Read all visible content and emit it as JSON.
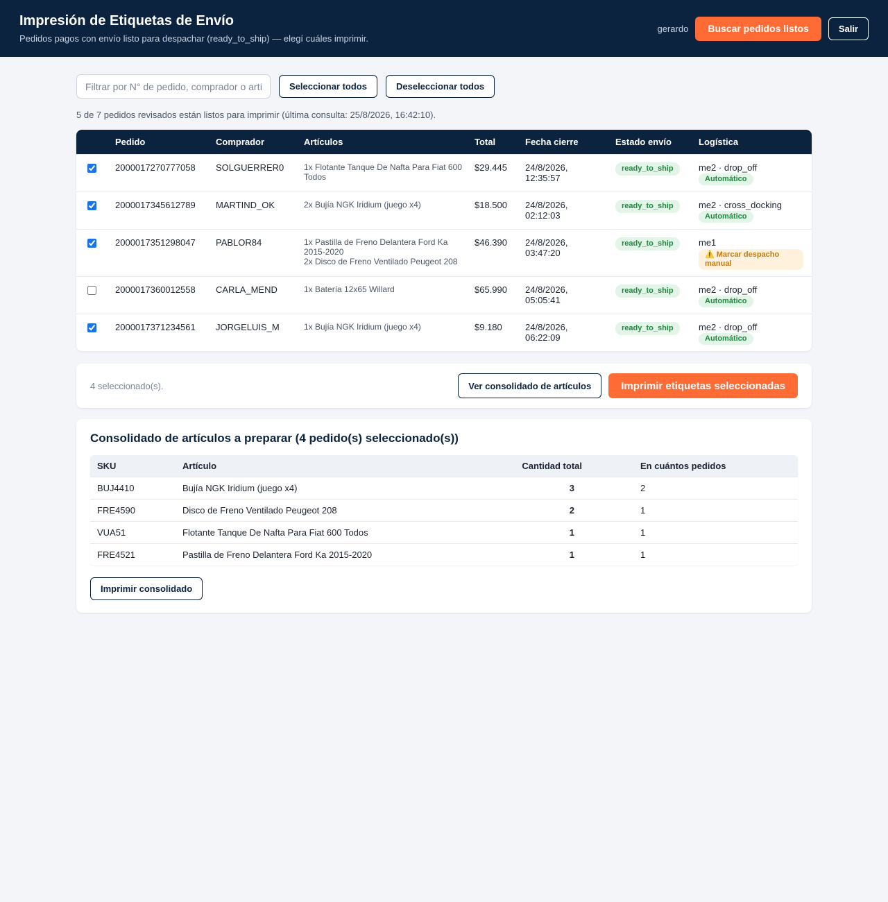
{
  "header": {
    "title": "Impresión de Etiquetas de Envío",
    "subtitle": "Pedidos pagos con envío listo para despachar (ready_to_ship) — elegí cuáles imprimir.",
    "user": "gerardo",
    "search_button": "Buscar pedidos listos",
    "logout_button": "Salir"
  },
  "toolbar": {
    "filter_placeholder": "Filtrar por N° de pedido, comprador o artículo",
    "select_all": "Seleccionar todos",
    "deselect_all": "Deseleccionar todos"
  },
  "status_line": "5 de 7 pedidos revisados están listos para imprimir (última consulta: 25/8/2026, 16:42:10).",
  "orders": {
    "columns": [
      "Pedido",
      "Comprador",
      "Artículos",
      "Total",
      "Fecha cierre",
      "Estado envío",
      "Logística"
    ],
    "rows": [
      {
        "checked": true,
        "id": "2000017270777058",
        "buyer": "SOLGUERRER0",
        "items": [
          "1x Flotante Tanque De Nafta Para Fiat 600 Todos"
        ],
        "total": "$29.445",
        "date": "24/8/2026,",
        "time": "12:35:57",
        "status": "ready_to_ship",
        "logistic": "me2 · drop_off",
        "mode": "Automático"
      },
      {
        "checked": true,
        "id": "2000017345612789",
        "buyer": "MARTIND_OK",
        "items": [
          "2x Bujía NGK Iridium (juego x4)"
        ],
        "total": "$18.500",
        "date": "24/8/2026,",
        "time": "02:12:03",
        "status": "ready_to_ship",
        "logistic": "me2 · cross_docking",
        "mode": "Automático"
      },
      {
        "checked": true,
        "id": "2000017351298047",
        "buyer": "PABLOR84",
        "items": [
          "1x Pastilla de Freno Delantera Ford Ka 2015-2020",
          "2x Disco de Freno Ventilado Peugeot 208"
        ],
        "total": "$46.390",
        "date": "24/8/2026,",
        "time": "03:47:20",
        "status": "ready_to_ship",
        "logistic": "me1",
        "warning": "⚠️ Marcar despacho manual"
      },
      {
        "checked": false,
        "id": "2000017360012558",
        "buyer": "CARLA_MEND",
        "items": [
          "1x Batería 12x65 Willard"
        ],
        "total": "$65.990",
        "date": "24/8/2026,",
        "time": "05:05:41",
        "status": "ready_to_ship",
        "logistic": "me2 · drop_off",
        "mode": "Automático"
      },
      {
        "checked": true,
        "id": "2000017371234561",
        "buyer": "JORGELUIS_M",
        "items": [
          "1x Bujía NGK Iridium (juego x4)"
        ],
        "total": "$9.180",
        "date": "24/8/2026,",
        "time": "06:22:09",
        "status": "ready_to_ship",
        "logistic": "me2 · drop_off",
        "mode": "Automático"
      }
    ]
  },
  "actions": {
    "selected_count": "4 seleccionado(s).",
    "view_consolidated": "Ver consolidado de artículos",
    "print_selected": "Imprimir etiquetas seleccionadas"
  },
  "consolidated": {
    "title": "Consolidado de artículos a preparar (4 pedido(s) seleccionado(s))",
    "columns": [
      "SKU",
      "Artículo",
      "Cantidad total",
      "En cuántos pedidos"
    ],
    "rows": [
      {
        "sku": "BUJ4410",
        "item": "Bujía NGK Iridium (juego x4)",
        "qty": "3",
        "orders": "2"
      },
      {
        "sku": "FRE4590",
        "item": "Disco de Freno Ventilado Peugeot 208",
        "qty": "2",
        "orders": "1"
      },
      {
        "sku": "VUA51",
        "item": "Flotante Tanque De Nafta Para Fiat 600 Todos",
        "qty": "1",
        "orders": "1"
      },
      {
        "sku": "FRE4521",
        "item": "Pastilla de Freno Delantera Ford Ka 2015-2020",
        "qty": "1",
        "orders": "1"
      }
    ],
    "print_button": "Imprimir consolidado"
  },
  "colors": {
    "header_bg": "#0c2340",
    "accent": "#ff6b35",
    "status_green": "#1e8a3e",
    "warning": "#c47a10"
  }
}
